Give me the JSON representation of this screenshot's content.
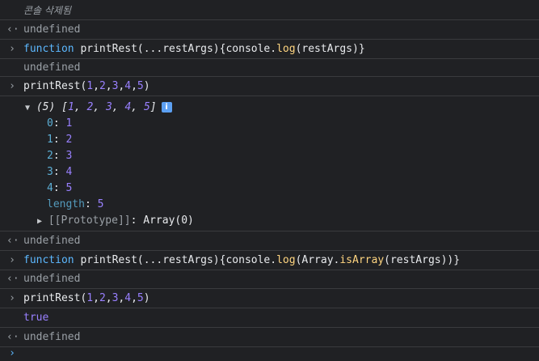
{
  "cleared_message": "콘솔 삭제됨",
  "undefined": "undefined",
  "icons": {
    "prompt": "›",
    "return": "‹·",
    "expand_open": "▼",
    "expand_closed": "▶",
    "info": "i"
  },
  "cmd1": {
    "keyword": "function",
    "before_log": " printRest(...restArgs){console.",
    "log": "log",
    "after_log": "(restArgs)}"
  },
  "cmd2": {
    "name": "printRest(",
    "args": [
      "1",
      "2",
      "3",
      "4",
      "5"
    ],
    "close": ")"
  },
  "array_summary": {
    "count": "(5)",
    "open": "[",
    "items": [
      "1",
      "2",
      "3",
      "4",
      "5"
    ],
    "close": "]"
  },
  "array_entries": [
    {
      "key": "0",
      "value": "1"
    },
    {
      "key": "1",
      "value": "2"
    },
    {
      "key": "2",
      "value": "3"
    },
    {
      "key": "3",
      "value": "4"
    },
    {
      "key": "4",
      "value": "5"
    }
  ],
  "length_key": "length",
  "length_value": "5",
  "prototype_key": "[[Prototype]]",
  "prototype_value": "Array(0)",
  "cmd3": {
    "keyword": "function",
    "before_log": " printRest(...restArgs){console.",
    "log": "log",
    "mid": "(Array.",
    "isArray": "isArray",
    "after": "(restArgs))}"
  },
  "cmd4": {
    "name": "printRest(",
    "args": [
      "1",
      "2",
      "3",
      "4",
      "5"
    ],
    "close": ")"
  },
  "result_true": "true"
}
